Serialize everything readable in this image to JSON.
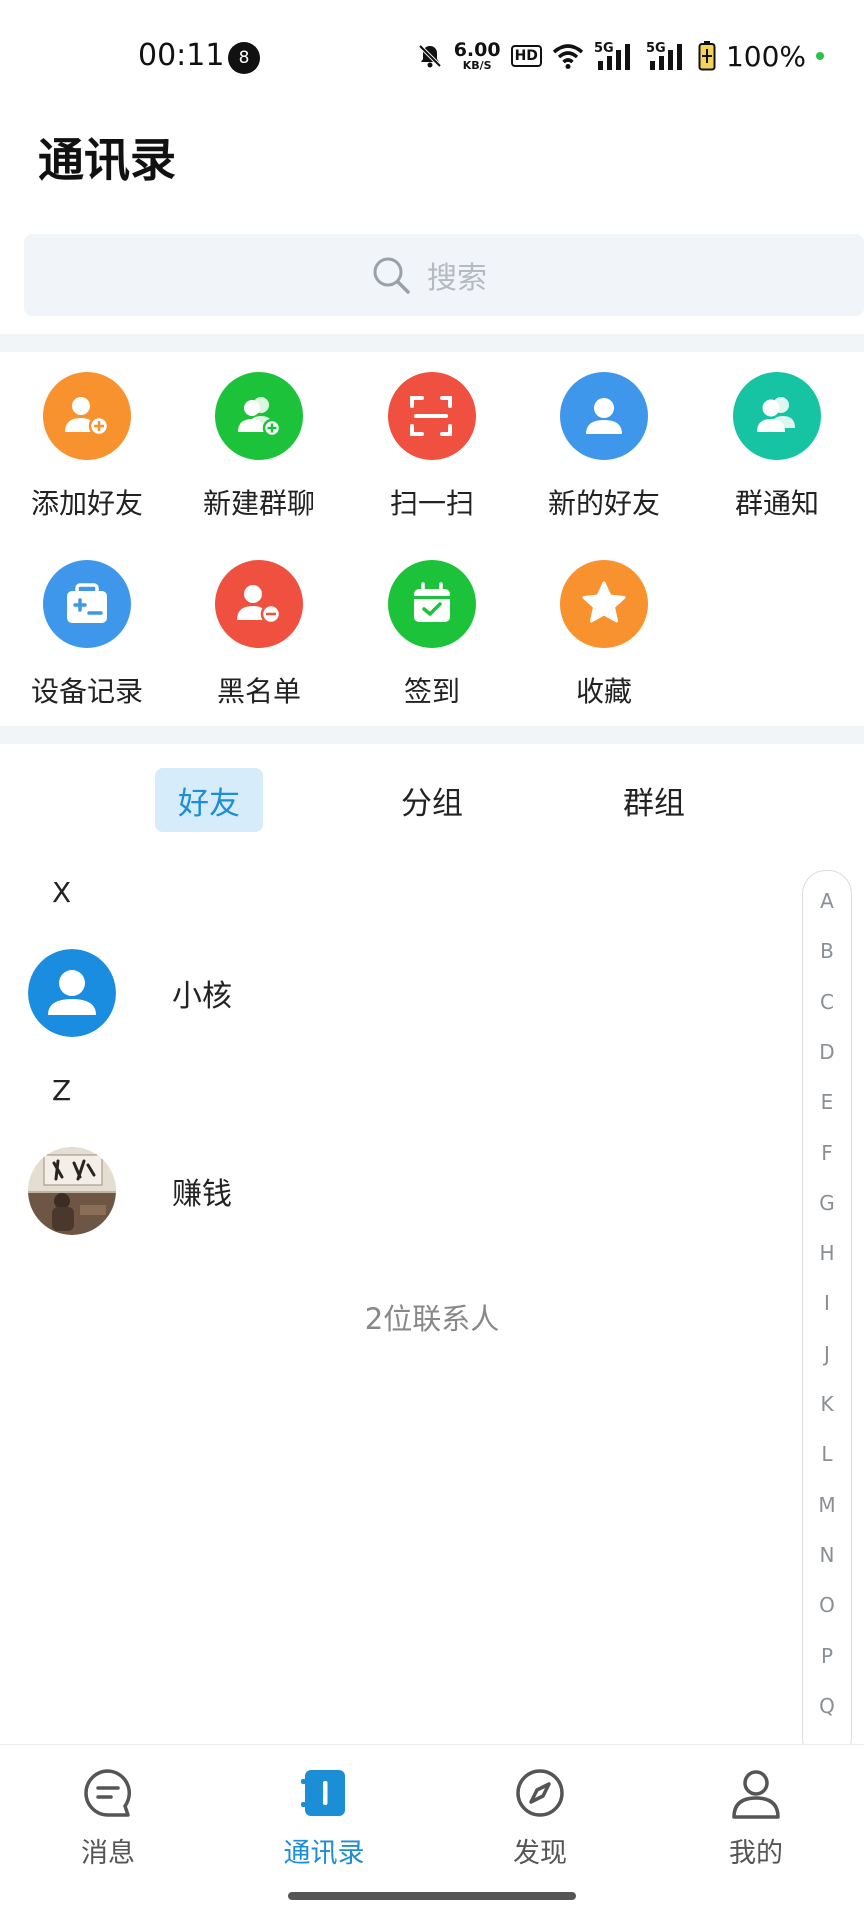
{
  "status_bar": {
    "time": "00:11",
    "notification_count": "8",
    "net_speed_value": "6.00",
    "net_speed_unit": "KB/S",
    "hd_label": "HD",
    "signal1_label": "5G",
    "signal2_label": "5G",
    "battery": "100%"
  },
  "header": {
    "title": "通讯录"
  },
  "search": {
    "placeholder": "搜索"
  },
  "actions": [
    {
      "label": "添加好友",
      "icon": "add-friend-icon",
      "color": "#f7922e"
    },
    {
      "label": "新建群聊",
      "icon": "new-group-chat-icon",
      "color": "#1cc33a"
    },
    {
      "label": "扫一扫",
      "icon": "scan-icon",
      "color": "#f0503f"
    },
    {
      "label": "新的好友",
      "icon": "new-friend-icon",
      "color": "#3f97ec"
    },
    {
      "label": "群通知",
      "icon": "group-notice-icon",
      "color": "#16c4a4"
    },
    {
      "label": "设备记录",
      "icon": "device-record-icon",
      "color": "#3f97ec"
    },
    {
      "label": "黑名单",
      "icon": "blacklist-icon",
      "color": "#f0503f"
    },
    {
      "label": "签到",
      "icon": "check-in-icon",
      "color": "#1cc33a"
    },
    {
      "label": "收藏",
      "icon": "favorites-icon",
      "color": "#f7922e"
    }
  ],
  "tabs": {
    "friends": "好友",
    "groups": "分组",
    "group_chats": "群组",
    "active": "friends"
  },
  "contacts": {
    "sections": [
      {
        "letter": "X",
        "name": "小核",
        "avatar": "default-user-avatar"
      },
      {
        "letter": "Z",
        "name": "赚钱",
        "avatar": "photo-avatar"
      }
    ],
    "count_text": "2位联系人"
  },
  "index_letters": [
    "A",
    "B",
    "C",
    "D",
    "E",
    "F",
    "G",
    "H",
    "I",
    "J",
    "K",
    "L",
    "M",
    "N",
    "O",
    "P",
    "Q"
  ],
  "bottom_nav": {
    "messages": "消息",
    "contacts": "通讯录",
    "discover": "发现",
    "me": "我的",
    "active": "contacts",
    "accent_color": "#1b8ed6"
  }
}
